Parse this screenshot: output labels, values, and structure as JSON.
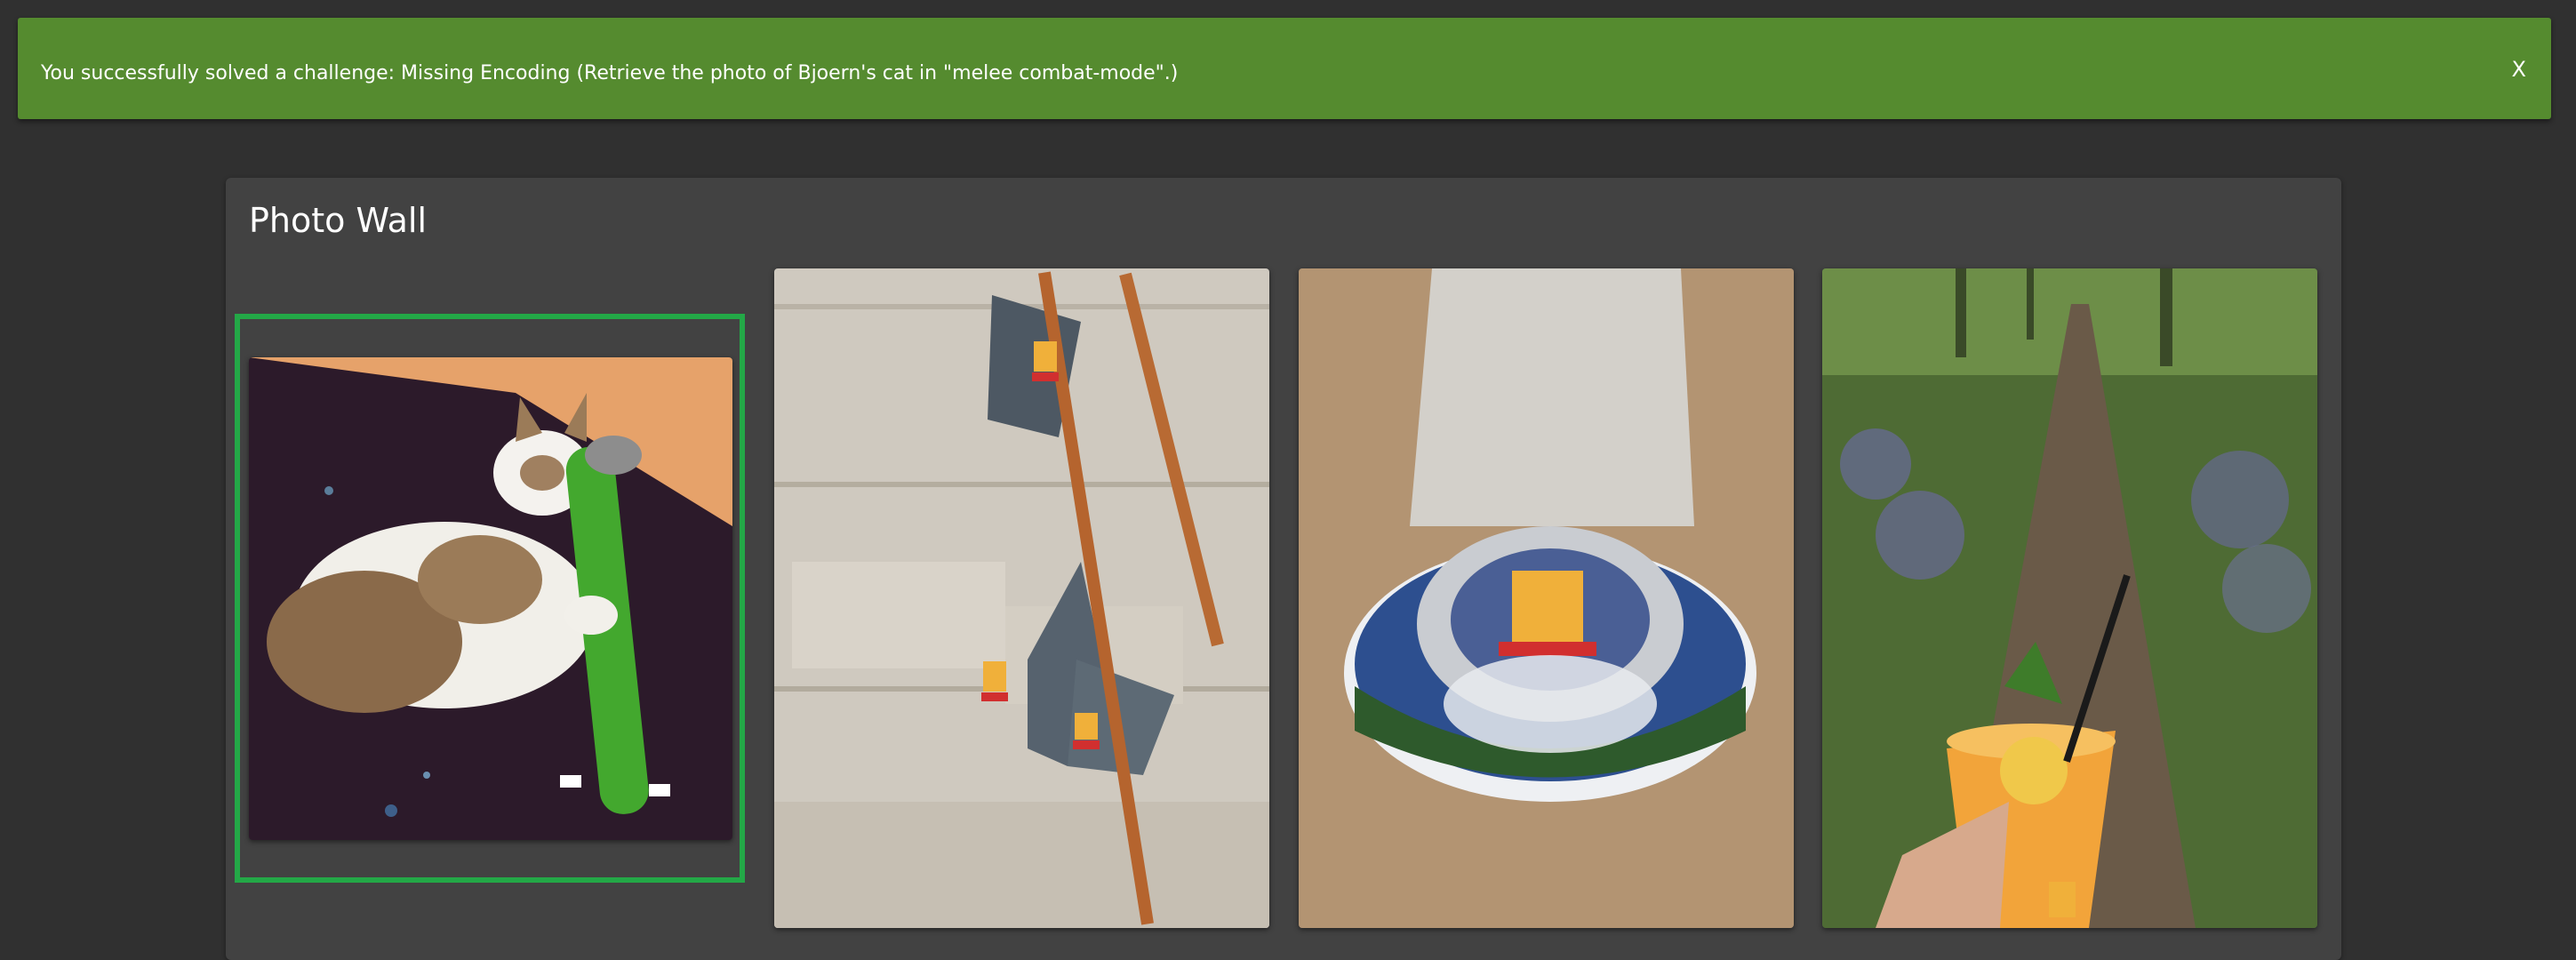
{
  "notification": {
    "message": "You successfully solved a challenge: Missing Encoding (Retrieve the photo of Bjoern's cat in \"melee combat-mode\".)",
    "close_label": "X",
    "color": "#558b2f"
  },
  "photo_wall": {
    "title": "Photo Wall",
    "highlight_color": "#23a847"
  }
}
